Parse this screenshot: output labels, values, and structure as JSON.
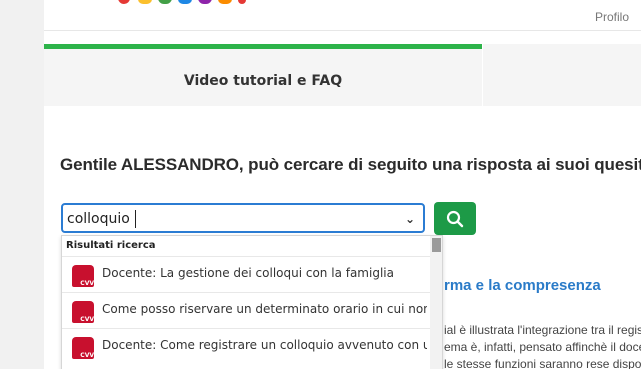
{
  "header": {
    "profile_label": "Profilo"
  },
  "tabs": [
    {
      "label": "Video tutorial e FAQ",
      "active": true
    }
  ],
  "greeting": "Gentile ALESSANDRO, può cercare di seguito una risposta ai suoi quesiti.",
  "search": {
    "value": "colloquio"
  },
  "dropdown": {
    "header": "Risultati ricerca",
    "items": [
      {
        "label": "Docente: La gestione dei colloqui con la famiglia",
        "icon": "cvv-icon"
      },
      {
        "label": "Come posso riservare un determinato orario in cui non ricevo",
        "icon": "cvv-icon"
      },
      {
        "label": "Docente: Come registrare un colloquio avvenuto con un genitore",
        "icon": "cvv-icon"
      }
    ]
  },
  "background_article": {
    "title": "rma e la compresenza",
    "lines": [
      "ial è illustrata l'integrazione tra il regist",
      "ema è, infatti, pensato affinchè il docente",
      "le stesse funzioni saranno rese disponibili"
    ]
  },
  "colors": {
    "accent_green": "#2db34a",
    "button_green": "#1d9a47",
    "focus_blue": "#2b7cd3",
    "title_blue": "#2a7bc8",
    "icon_red": "#c8102e"
  }
}
